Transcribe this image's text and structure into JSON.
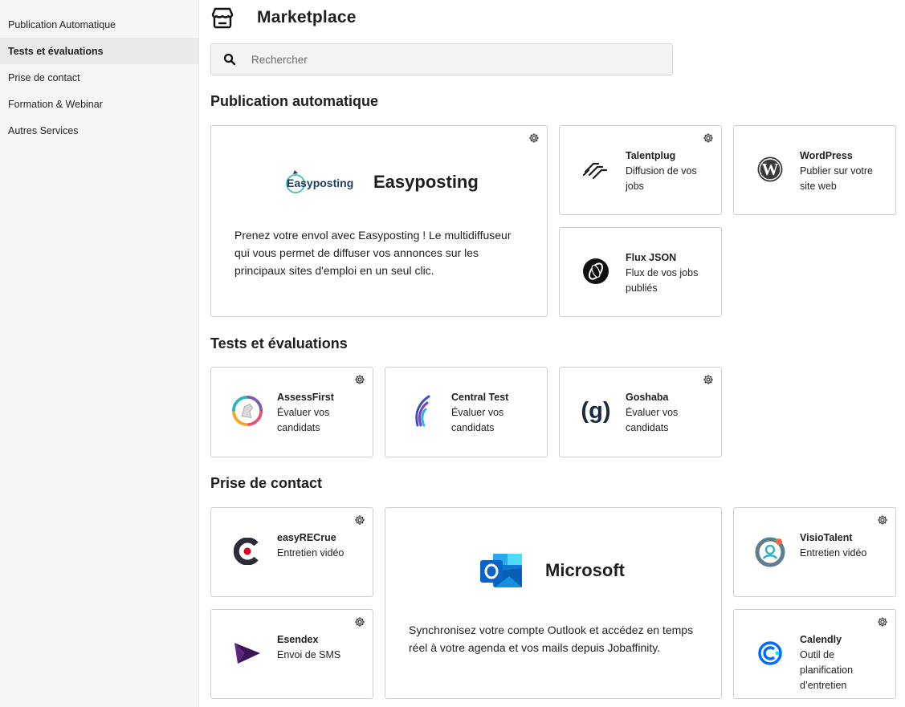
{
  "sidebar": {
    "items": [
      {
        "label": "Publication Automatique",
        "active": false
      },
      {
        "label": "Tests et évaluations",
        "active": true
      },
      {
        "label": "Prise de contact",
        "active": false
      },
      {
        "label": "Formation & Webinar",
        "active": false
      },
      {
        "label": "Autres Services",
        "active": false
      }
    ]
  },
  "header": {
    "title": "Marketplace",
    "icon": "store-icon"
  },
  "search": {
    "placeholder": "Rechercher",
    "value": ""
  },
  "sections": {
    "publication": {
      "title": "Publication automatique",
      "featured": {
        "name": "Easyposting",
        "logo_text": "Easyposting",
        "description": "Prenez votre envol avec Easyposting ! Le multidiffuseur qui vous permet de diffuser vos annonces sur les principaux sites d'emploi en un seul clic."
      },
      "cards": [
        {
          "name": "Talentplug",
          "description": "Diffusion de vos jobs"
        },
        {
          "name": "WordPress",
          "description": "Publier sur votre site web"
        },
        {
          "name": "Flux JSON",
          "description": "Flux de vos jobs publiés"
        }
      ]
    },
    "tests": {
      "title": "Tests et évaluations",
      "cards": [
        {
          "name": "AssessFirst",
          "description": "Évaluer vos candidats"
        },
        {
          "name": "Central Test",
          "description": "Évaluer vos candidats"
        },
        {
          "name": "Goshaba",
          "description": "Évaluer vos candidats"
        }
      ]
    },
    "contact": {
      "title": "Prise de contact",
      "featured": {
        "name": "Microsoft",
        "description": "Synchronisez votre compte Outlook et accédez en temps réel à votre agenda et vos mails depuis Jobaffinity."
      },
      "cards": [
        {
          "name": "easyRECrue",
          "description": "Entretien vidéo"
        },
        {
          "name": "Esendex",
          "description": "Envoi de SMS"
        },
        {
          "name": "VisioTalent",
          "description": "Entretien vidéo"
        },
        {
          "name": "Calendly",
          "description": "Outil de planification d’entretien"
        }
      ]
    }
  },
  "colors": {
    "accent_blue": "#1e88e5",
    "outlook_blue": "#0a64c8",
    "sidebar_bg": "#f6f6f6"
  }
}
